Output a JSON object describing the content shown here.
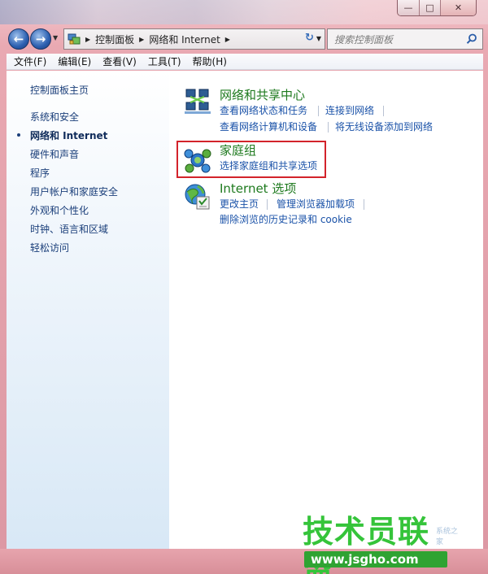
{
  "window": {
    "caption": {
      "minimize": "—",
      "maximize": "□",
      "close": "✕"
    }
  },
  "address": {
    "crumbs": [
      "控制面板",
      "网络和 Internet"
    ],
    "search_placeholder": "搜索控制面板"
  },
  "menu": [
    "文件(F)",
    "编辑(E)",
    "查看(V)",
    "工具(T)",
    "帮助(H)"
  ],
  "left_pane": {
    "home": "控制面板主页",
    "items": [
      "系统和安全",
      "网络和 Internet",
      "硬件和声音",
      "程序",
      "用户帐户和家庭安全",
      "外观和个性化",
      "时钟、语言和区域",
      "轻松访问"
    ],
    "current_index": 1
  },
  "categories": [
    {
      "title": "网络和共享中心",
      "links": [
        "查看网络状态和任务",
        "连接到网络",
        "查看网络计算机和设备",
        "将无线设备添加到网络"
      ],
      "icon": "network-sharing-icon"
    },
    {
      "title": "家庭组",
      "links": [
        "选择家庭组和共享选项"
      ],
      "icon": "homegroup-icon",
      "highlighted": true
    },
    {
      "title": "Internet 选项",
      "links": [
        "更改主页",
        "管理浏览器加载项",
        "删除浏览的历史记录和 cookie"
      ],
      "icon": "internet-options-icon"
    }
  ],
  "watermark": {
    "title": "技术员联盟",
    "url": "www.jsgho.com",
    "side": "系统之家"
  },
  "colors": {
    "category_title": "#1e7a1e",
    "link": "#1a52a8",
    "highlight": "#d3232b",
    "watermark_green": "#35c43a"
  }
}
